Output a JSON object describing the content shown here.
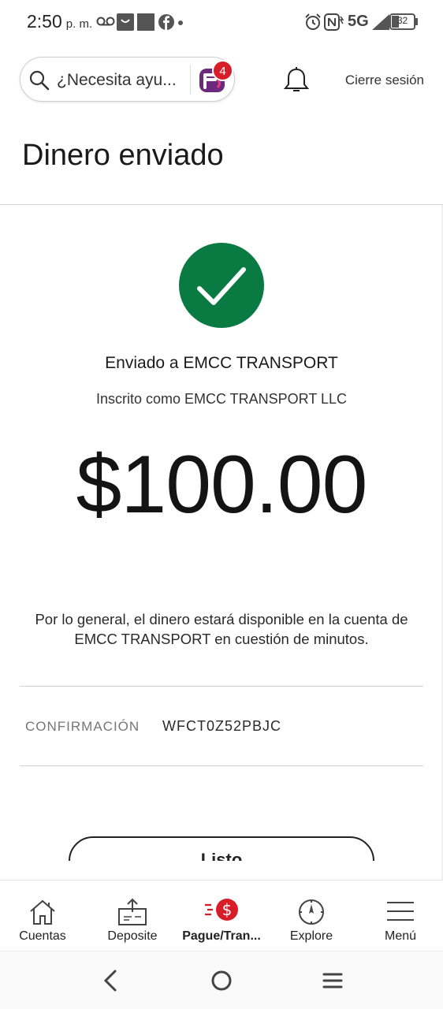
{
  "status_bar": {
    "time": "2:50",
    "time_suffix": "p. m.",
    "network": "5G",
    "battery": "32",
    "icons": [
      "voicemail-icon",
      "shopping-bag-icon",
      "square-icon",
      "facebook-icon",
      "dot-icon",
      "alarm-icon",
      "nfc-icon",
      "signal-icon",
      "battery-icon"
    ]
  },
  "header": {
    "search_placeholder": "¿Necesita ayu...",
    "notification_count": "4",
    "signout_label": "Cierre sesión"
  },
  "page": {
    "title": "Dinero enviado"
  },
  "confirmation": {
    "sent_to": "Enviado a EMCC TRANSPORT",
    "enrolled_as": "Inscrito como EMCC TRANSPORT LLC",
    "amount": "$100.00",
    "availability_note": "Por lo general, el dinero estará disponible en la cuenta de EMCC TRANSPORT en cuestión de minutos.",
    "confirmation_label": "CONFIRMACIÓN",
    "confirmation_value": "WFCT0Z52PBJC",
    "done_label": "Listo"
  },
  "colors": {
    "success": "#0a7a43",
    "brand_red": "#d71e28",
    "fargo_purple": "#6b2a7e"
  },
  "bottom_nav": {
    "items": [
      {
        "label": "Cuentas",
        "icon": "home-icon"
      },
      {
        "label": "Deposite",
        "icon": "deposit-icon"
      },
      {
        "label": "Pague/Tran...",
        "icon": "pay-transfer-icon",
        "active": true
      },
      {
        "label": "Explore",
        "icon": "compass-icon"
      },
      {
        "label": "Menú",
        "icon": "menu-icon"
      }
    ]
  },
  "android_nav": {
    "buttons": [
      "back-icon",
      "home-circle-icon",
      "recents-icon"
    ]
  }
}
